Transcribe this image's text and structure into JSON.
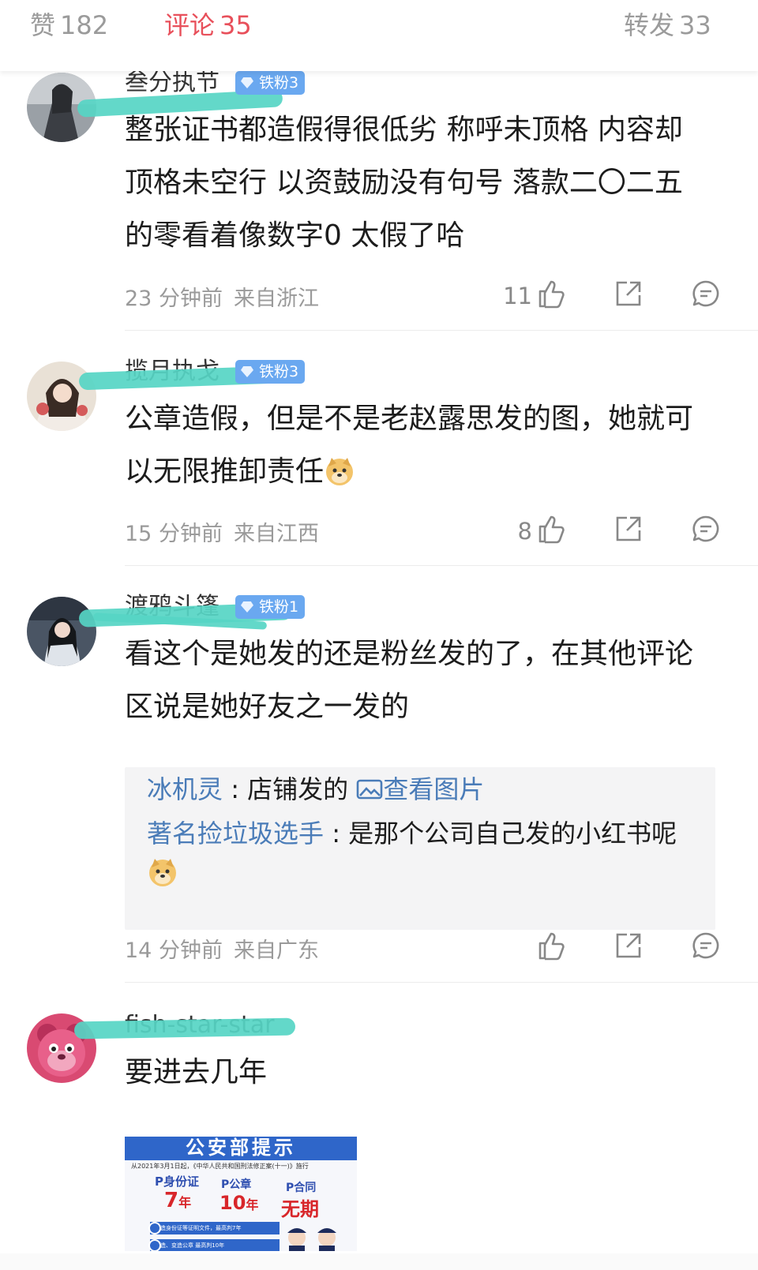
{
  "tabs": {
    "likes": {
      "label": "赞",
      "count": "182"
    },
    "comments": {
      "label": "评论",
      "count": "35"
    },
    "reposts": {
      "label": "转发",
      "count": "33"
    }
  },
  "colors": {
    "accent": "#e8505b",
    "badge": "#6aa8f0",
    "reply_name": "#4a7cb8",
    "scribble": "#56d5c4"
  },
  "comments": [
    {
      "username": "叁分执节",
      "badge": "铁粉3",
      "lines": [
        "整张证书都造假得很低劣 称呼未顶格 内容却",
        "顶格未空行 以资鼓励没有句号 落款二〇二五",
        "的零看着像数字0 太假了哈"
      ],
      "time": "23 分钟前",
      "location": "来自浙江",
      "likes": "11"
    },
    {
      "username": "揽月执戈",
      "badge": "铁粉3",
      "lines": [
        "公章造假，但是不是老赵露思发的图，她就可",
        "以无限推卸责任"
      ],
      "emoji": "doge",
      "time": "15 分钟前",
      "location": "来自江西",
      "likes": "8"
    },
    {
      "username": "渡鸦斗篷",
      "badge": "铁粉1",
      "lines": [
        "看这个是她发的还是粉丝发的了，在其他评论",
        "区说是她好友之一发的"
      ],
      "replies": [
        {
          "name": "冰机灵",
          "sep": ":",
          "text": "店铺发的",
          "link": "查看图片"
        },
        {
          "name": "著名捡垃圾选手",
          "sep": ":",
          "text": "是那个公司自己发的小红书呢",
          "emoji": "doge"
        }
      ],
      "time": "14 分钟前",
      "location": "来自广东",
      "likes": ""
    },
    {
      "username": "fish-star-star",
      "lines": [
        "要进去几年"
      ],
      "image": {
        "header": "公安部提示",
        "intro": "从2021年3月1日起，《中华人民共和国刑法修正案(十一)》施行",
        "items": [
          {
            "label": "P身份证",
            "years": "7",
            "unit": "年"
          },
          {
            "label": "P公章",
            "years": "10",
            "unit": "年"
          },
          {
            "label": "P合同",
            "years": "无期",
            "unit": ""
          }
        ],
        "rows": [
          "伪造身份证等证明文件，最高判7年",
          "伪造、变造公章 最高判10年"
        ]
      }
    }
  ]
}
